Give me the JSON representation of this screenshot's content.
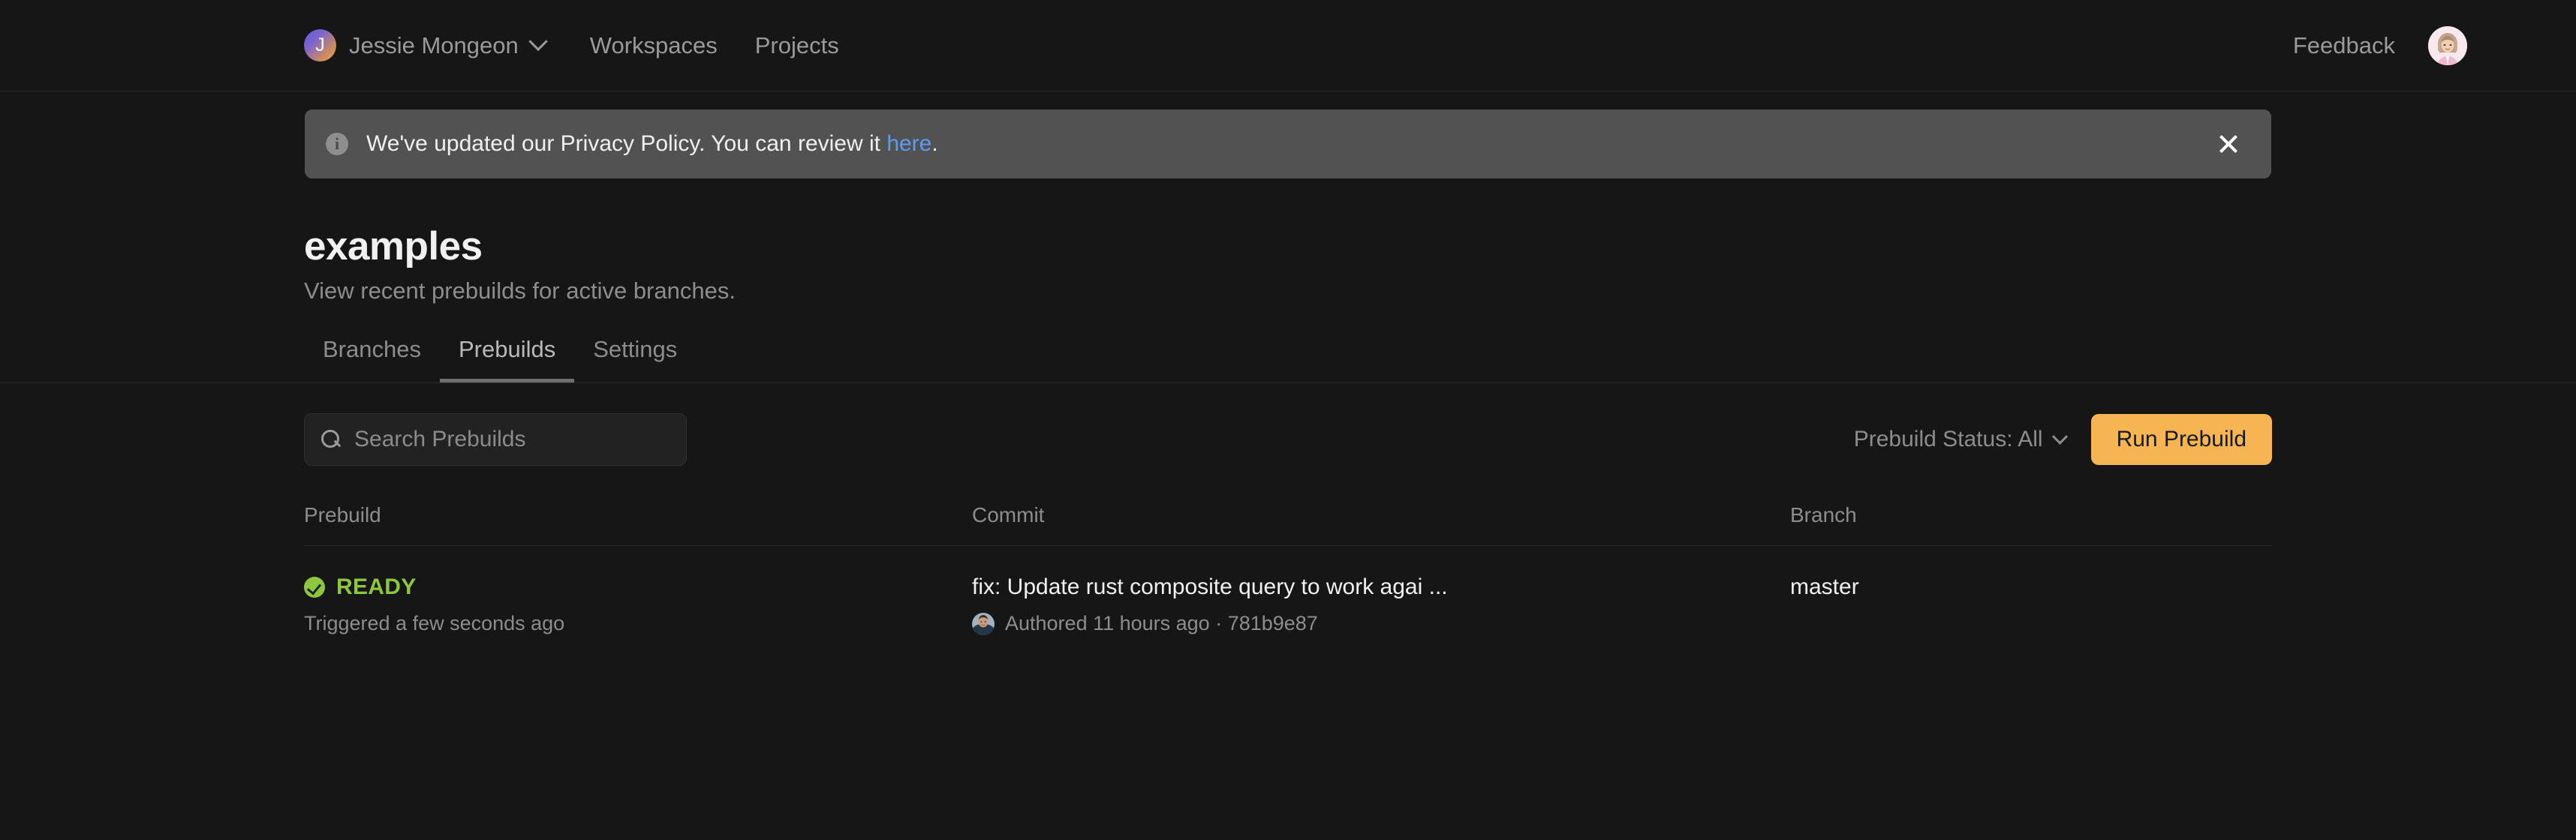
{
  "topbar": {
    "org": {
      "avatar_initial": "J",
      "name": "Jessie Mongeon",
      "chevron_icon": "chevron-down-icon"
    },
    "nav_links": [
      {
        "label": "Workspaces"
      },
      {
        "label": "Projects"
      }
    ],
    "feedback_label": "Feedback",
    "user_avatar_icon": "user-avatar"
  },
  "banner": {
    "info_icon": "info-icon",
    "info_glyph": "i",
    "text_before": "We've updated our Privacy Policy. You can review it ",
    "link_label": "here",
    "text_after": ".",
    "close_icon": "close-icon"
  },
  "page": {
    "title": "examples",
    "subtitle": "View recent prebuilds for active branches."
  },
  "tabs": [
    {
      "label": "Branches",
      "active": false
    },
    {
      "label": "Prebuilds",
      "active": true
    },
    {
      "label": "Settings",
      "active": false
    }
  ],
  "toolbar": {
    "search": {
      "icon": "search-icon",
      "value": "",
      "placeholder": "Search Prebuilds"
    },
    "status_filter": {
      "label": "Prebuild Status: All",
      "chevron_icon": "chevron-down-icon"
    },
    "run_button_label": "Run Prebuild"
  },
  "table": {
    "columns": [
      {
        "label": "Prebuild"
      },
      {
        "label": "Commit"
      },
      {
        "label": "Branch"
      }
    ],
    "rows": [
      {
        "status_icon": "check-circle-icon",
        "status": "READY",
        "triggered": "Triggered a few seconds ago",
        "commit_message": "fix: Update rust composite query to work agai ...",
        "commit_author_avatar": "commit-author-avatar",
        "commit_meta": "Authored 11 hours ago · 781b9e87",
        "branch": "master"
      }
    ]
  },
  "colors": {
    "page_background": "#161616",
    "banner_background": "#525252",
    "accent_button": "#f5b552",
    "link_blue": "#5b9bf3",
    "status_green": "#8dc63f",
    "muted_text": "#8d8d8d",
    "primary_text": "#f1f1f1",
    "active_tab_underline": "#6e6e6e"
  }
}
